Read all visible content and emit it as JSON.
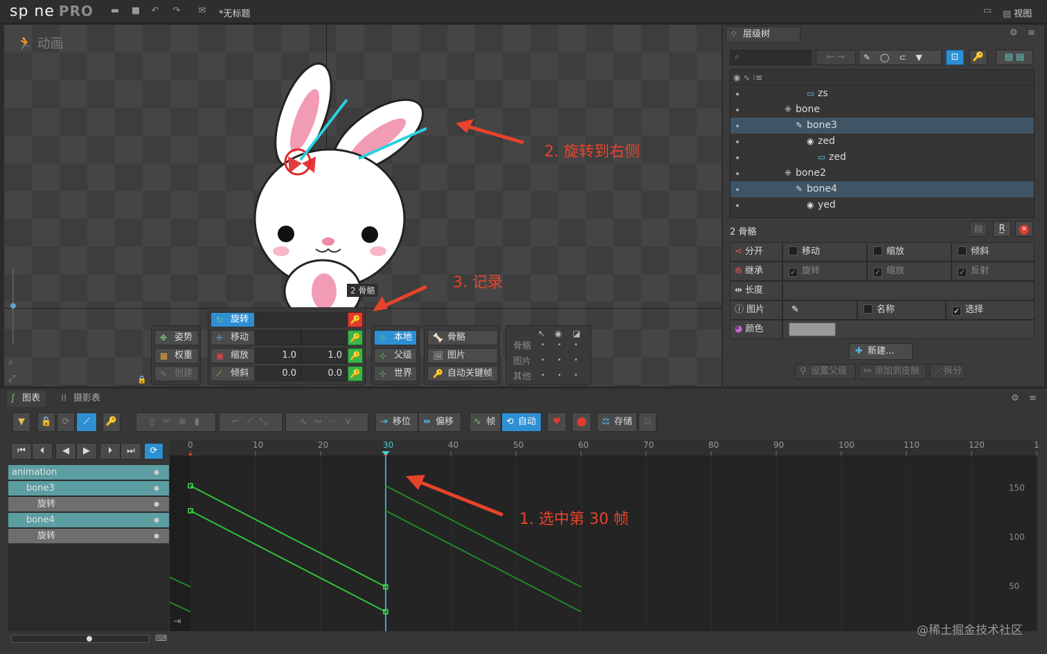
{
  "app": {
    "logo": "sp ne",
    "logo_pro": "PRO",
    "doc_title": "*无标题",
    "view_menu": "视图"
  },
  "viewport": {
    "mode_label": "动画",
    "bone_badge": "2 骨骼"
  },
  "annotations": {
    "step1": "1. 选中第 30 帧",
    "step2": "2. 旋转到右侧",
    "step3": "3. 记录"
  },
  "transform": {
    "rotate": "旋转",
    "translate": "移动",
    "scale": "缩放",
    "shear": "倾斜",
    "scale_x": "1.0",
    "scale_y": "1.0",
    "shear_x": "0.0",
    "shear_y": "0.0",
    "pose": "姿势",
    "weights": "权重",
    "create": "创建",
    "local": "本地",
    "parent": "父级",
    "world": "世界",
    "bones": "骨骼",
    "images": "图片",
    "auto_key": "自动关键帧",
    "compensate": {
      "bones": "骨骼",
      "images": "图片",
      "others": "其他"
    }
  },
  "tree": {
    "tab": "层级树",
    "rows": [
      {
        "label": "zs",
        "indent": 5
      },
      {
        "label": "bone",
        "indent": 3
      },
      {
        "label": "bone3",
        "indent": 4
      },
      {
        "label": "zed",
        "indent": 5
      },
      {
        "label": "zed",
        "indent": 6
      },
      {
        "label": "bone2",
        "indent": 3
      },
      {
        "label": "bone4",
        "indent": 4
      },
      {
        "label": "yed",
        "indent": 5
      }
    ]
  },
  "props": {
    "header": "2 骨骼",
    "split": "分开",
    "translate": "移动",
    "scale": "缩放",
    "shear": "倾斜",
    "inherit": "继承",
    "rotation": "旋转",
    "inherit_scale": "缩放",
    "reflect": "反射",
    "length": "长度",
    "image": "图片",
    "name": "名称",
    "select": "选择",
    "color": "颜色",
    "color_hex": "#9a9a9a",
    "new": "新建...",
    "set_parent": "设置父级",
    "add_to_skin": "添加到皮肤",
    "split_btn": "拆分"
  },
  "bottom": {
    "tab_graph": "图表",
    "tab_dopesheet": "摄影表",
    "offset": "移位",
    "bias": "偏移",
    "frames": "帧",
    "auto": "自动",
    "store": "存储",
    "ruler": [
      "0",
      "10",
      "20",
      "30",
      "40",
      "50",
      "60",
      "70",
      "80",
      "90",
      "100",
      "110",
      "120",
      "1"
    ],
    "y_labels": [
      "150",
      "100",
      "50"
    ],
    "dope_rows": [
      {
        "label": "animation",
        "level": 0
      },
      {
        "label": "bone3",
        "level": 1
      },
      {
        "label": "旋转",
        "level": 2
      },
      {
        "label": "bone4",
        "level": 1
      },
      {
        "label": "旋转",
        "level": 2
      }
    ]
  },
  "watermark": "@稀土掘金技术社区"
}
